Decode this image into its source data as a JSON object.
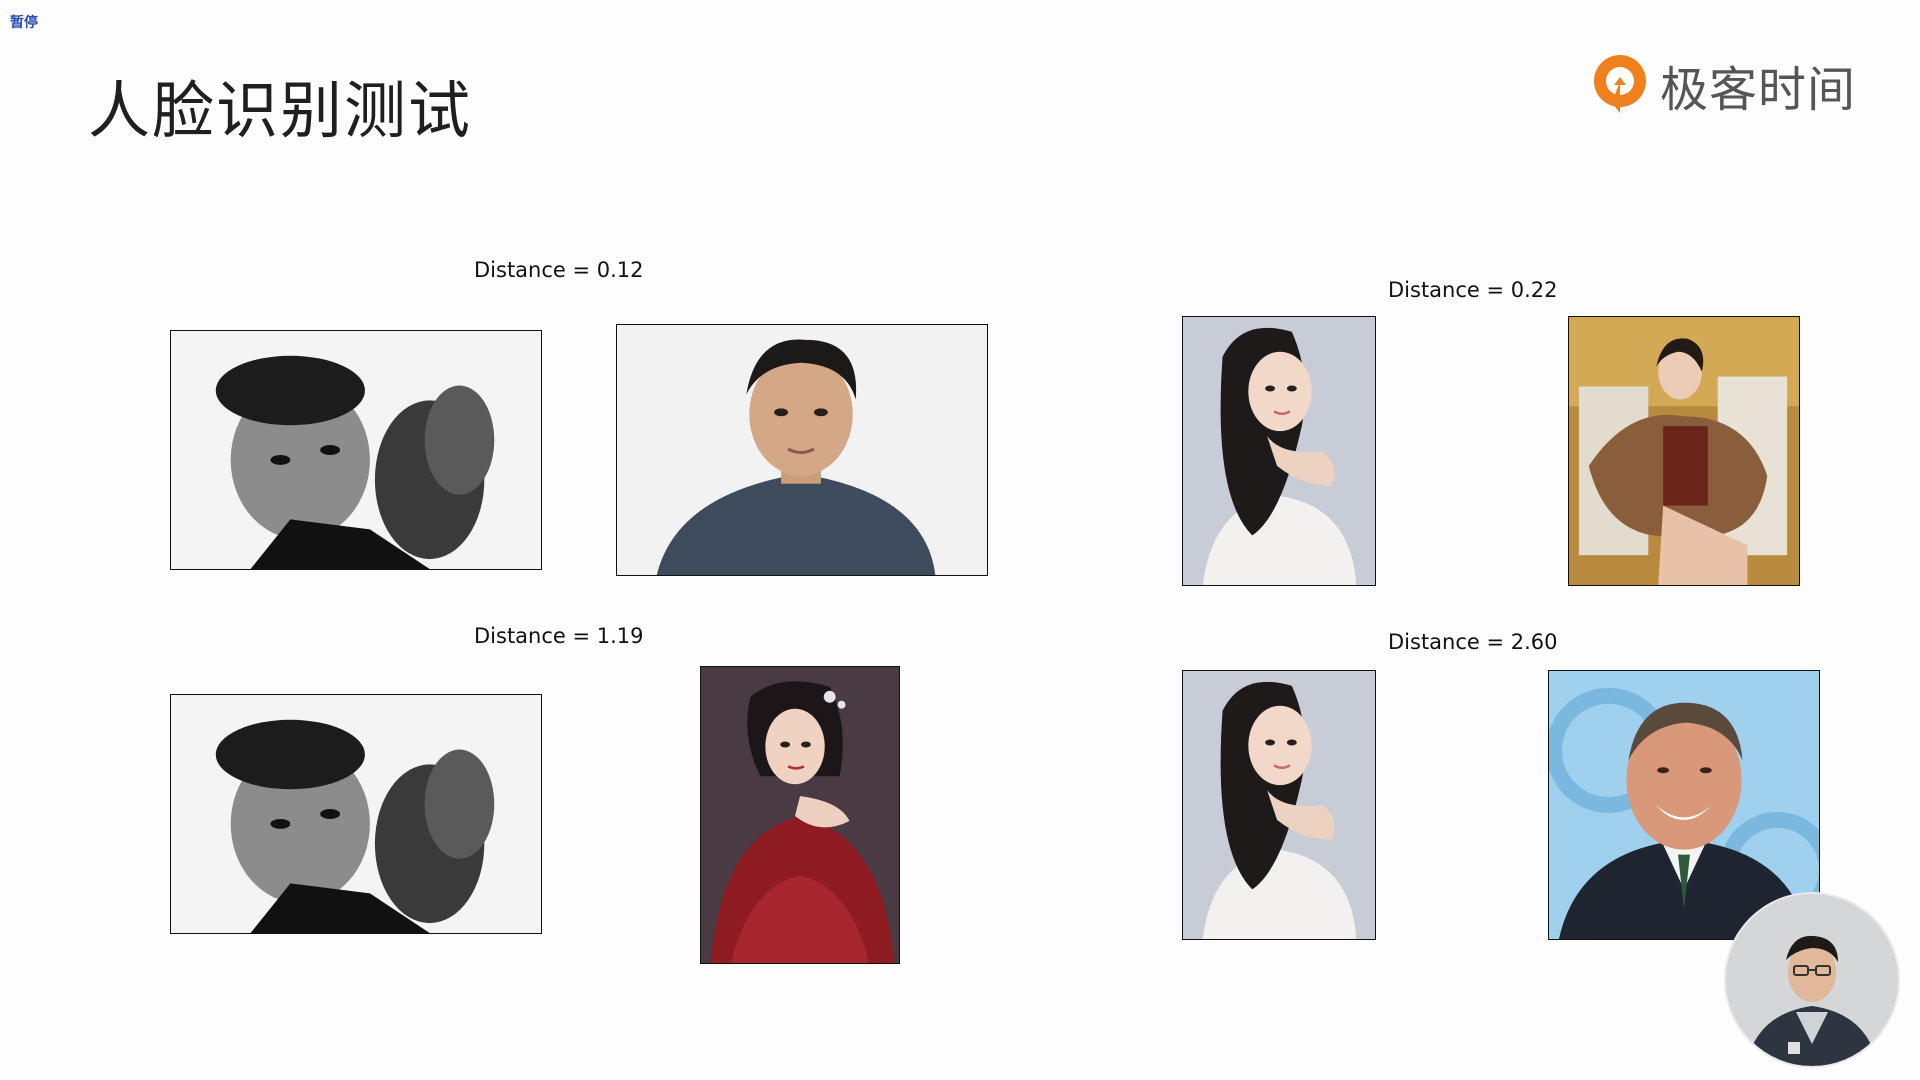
{
  "overlay": {
    "pause_label": "暂停"
  },
  "slide": {
    "title": "人脸识别测试"
  },
  "brand": {
    "name": "极客时间",
    "accent_color": "#f07f1e",
    "icon": "geek-time-logo"
  },
  "comparisons": [
    {
      "distance_label": "Distance = 0.12"
    },
    {
      "distance_label": "Distance = 0.22"
    },
    {
      "distance_label": "Distance = 1.19"
    },
    {
      "distance_label": "Distance = 2.60"
    }
  ],
  "presenter": {
    "icon": "presenter-video"
  }
}
